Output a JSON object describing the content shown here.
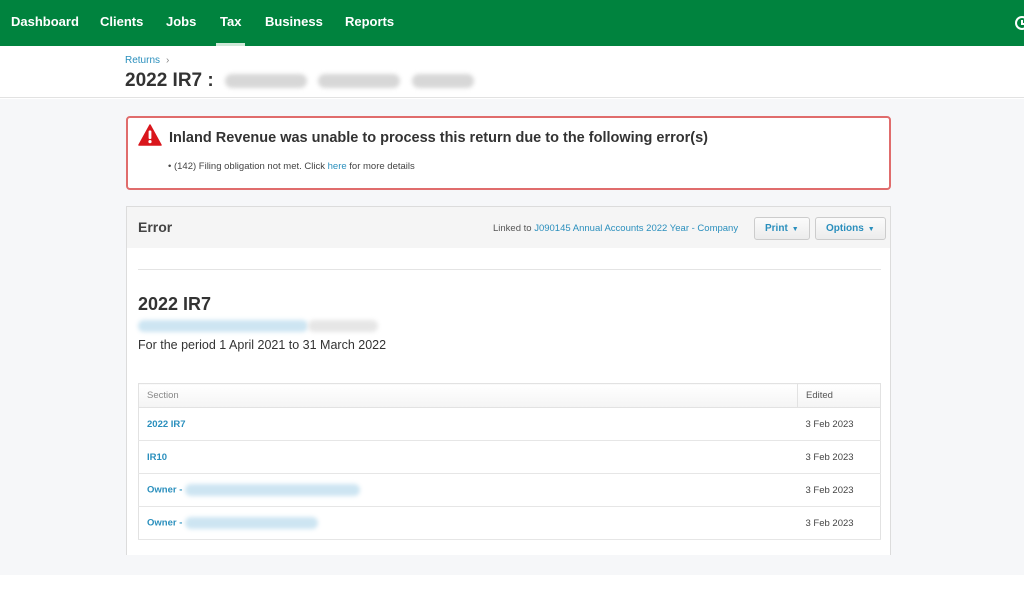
{
  "nav": {
    "items": [
      {
        "label": "Dashboard",
        "active": false
      },
      {
        "label": "Clients",
        "active": false
      },
      {
        "label": "Jobs",
        "active": false
      },
      {
        "label": "Tax",
        "active": true
      },
      {
        "label": "Business",
        "active": false
      },
      {
        "label": "Reports",
        "active": false
      }
    ],
    "right_icon": "clock-icon",
    "color": "#00833e"
  },
  "header": {
    "breadcrumb": "Returns",
    "breadcrumb_sep": "›",
    "title": "2022 IR7 :",
    "title_redacted": "[redacted client name]"
  },
  "alert": {
    "icon": "warning-triangle-icon",
    "title": "Inland Revenue was unable to process this return due to the following error(s)",
    "item_prefix": "• (142) Filing obligation not met. Click ",
    "item_link": "here",
    "item_suffix": " for more details",
    "border_color": "#e06c6c"
  },
  "panel": {
    "title": "Error",
    "linked_prefix": "Linked to ",
    "linked_link": "J090145 Annual Accounts 2022 Year - Company",
    "print_label": "Print",
    "options_label": "Options",
    "caret": "▼"
  },
  "document": {
    "title": "2022 IR7",
    "subtitle_redacted": "[redacted]",
    "period": "For the period 1 April 2021 to 31 March 2022"
  },
  "table": {
    "headers": {
      "section": "Section",
      "edited": "Edited"
    },
    "rows": [
      {
        "section": "2022 IR7",
        "redacted": false,
        "edited": "3 Feb 2023"
      },
      {
        "section": "IR10",
        "redacted": false,
        "edited": "3 Feb 2023"
      },
      {
        "section": "Owner - ",
        "redacted": true,
        "edited": "3 Feb 2023"
      },
      {
        "section": "Owner - ",
        "redacted": true,
        "edited": "3 Feb 2023"
      }
    ]
  },
  "colors": {
    "link": "#2a8fbd",
    "background": "#f6f7f9"
  }
}
